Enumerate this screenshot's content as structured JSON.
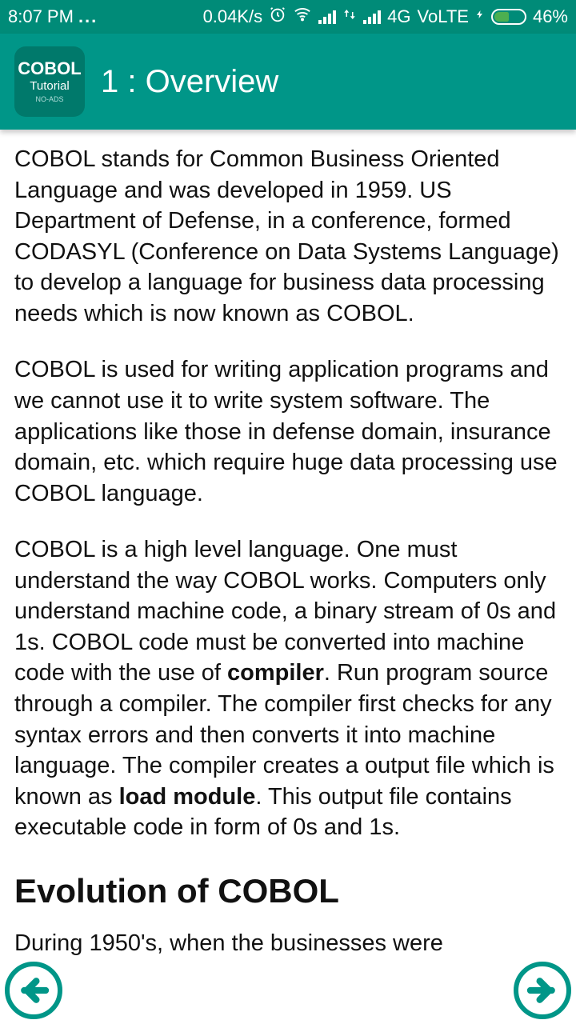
{
  "status": {
    "time": "8:07 PM",
    "dots": "...",
    "speed": "0.04K/s",
    "network": "4G",
    "volte": "VoLTE",
    "battery_pct": "46%"
  },
  "header": {
    "icon_line1": "COBOL",
    "icon_line2": "Tutorial",
    "icon_line3": "NO-ADS",
    "title": "1 : Overview"
  },
  "body": {
    "p1": "COBOL stands for Common Business Oriented Language and was developed in 1959. US Department of Defense, in a conference, formed CODASYL (Conference on Data Systems Language) to develop a language for business data processing needs which is now known as COBOL.",
    "p2": "COBOL is used for writing application programs and we cannot use it to write system software. The applications like those in defense domain, insurance domain, etc. which require huge data processing use COBOL language.",
    "p3a": "COBOL is a high level language. One must understand the way COBOL works. Computers only understand machine code, a binary stream of 0s and 1s. COBOL code must be converted into machine code with the use of ",
    "p3b_bold": "compiler",
    "p3c": ". Run program source through a compiler. The compiler first checks for any syntax errors and then converts it into machine language. The compiler creates a output file which is known as ",
    "p3d_bold": "load module",
    "p3e": ". This output file contains executable code in form of 0s and 1s.",
    "h2": "Evolution of COBOL",
    "p4": "During 1950's, when the businesses were"
  }
}
